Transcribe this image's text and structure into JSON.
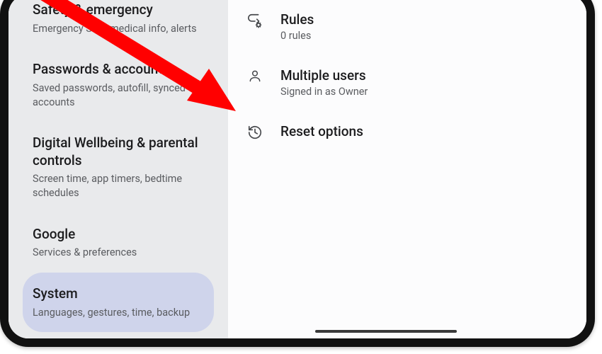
{
  "sidebar": [
    {
      "title": "Safety & emergency",
      "sub": "Emergency SOS, medical info, alerts",
      "selected": false
    },
    {
      "title": "Passwords & accounts",
      "sub": "Saved passwords, autofill, synced accounts",
      "selected": false
    },
    {
      "title": "Digital Wellbeing & parental controls",
      "sub": "Screen time, app timers, bedtime schedules",
      "selected": false
    },
    {
      "title": "Google",
      "sub": "Services & preferences",
      "selected": false
    },
    {
      "title": "System",
      "sub": "Languages, gestures, time, backup",
      "selected": true
    }
  ],
  "main_rows": [
    {
      "icon": "rules-icon",
      "title": "Rules",
      "sub": "0 rules"
    },
    {
      "icon": "person-icon",
      "title": "Multiple users",
      "sub": "Signed in as Owner"
    },
    {
      "icon": "history-icon",
      "title": "Reset options",
      "sub": ""
    }
  ],
  "annotation": {
    "arrow_color": "#ff0000"
  }
}
